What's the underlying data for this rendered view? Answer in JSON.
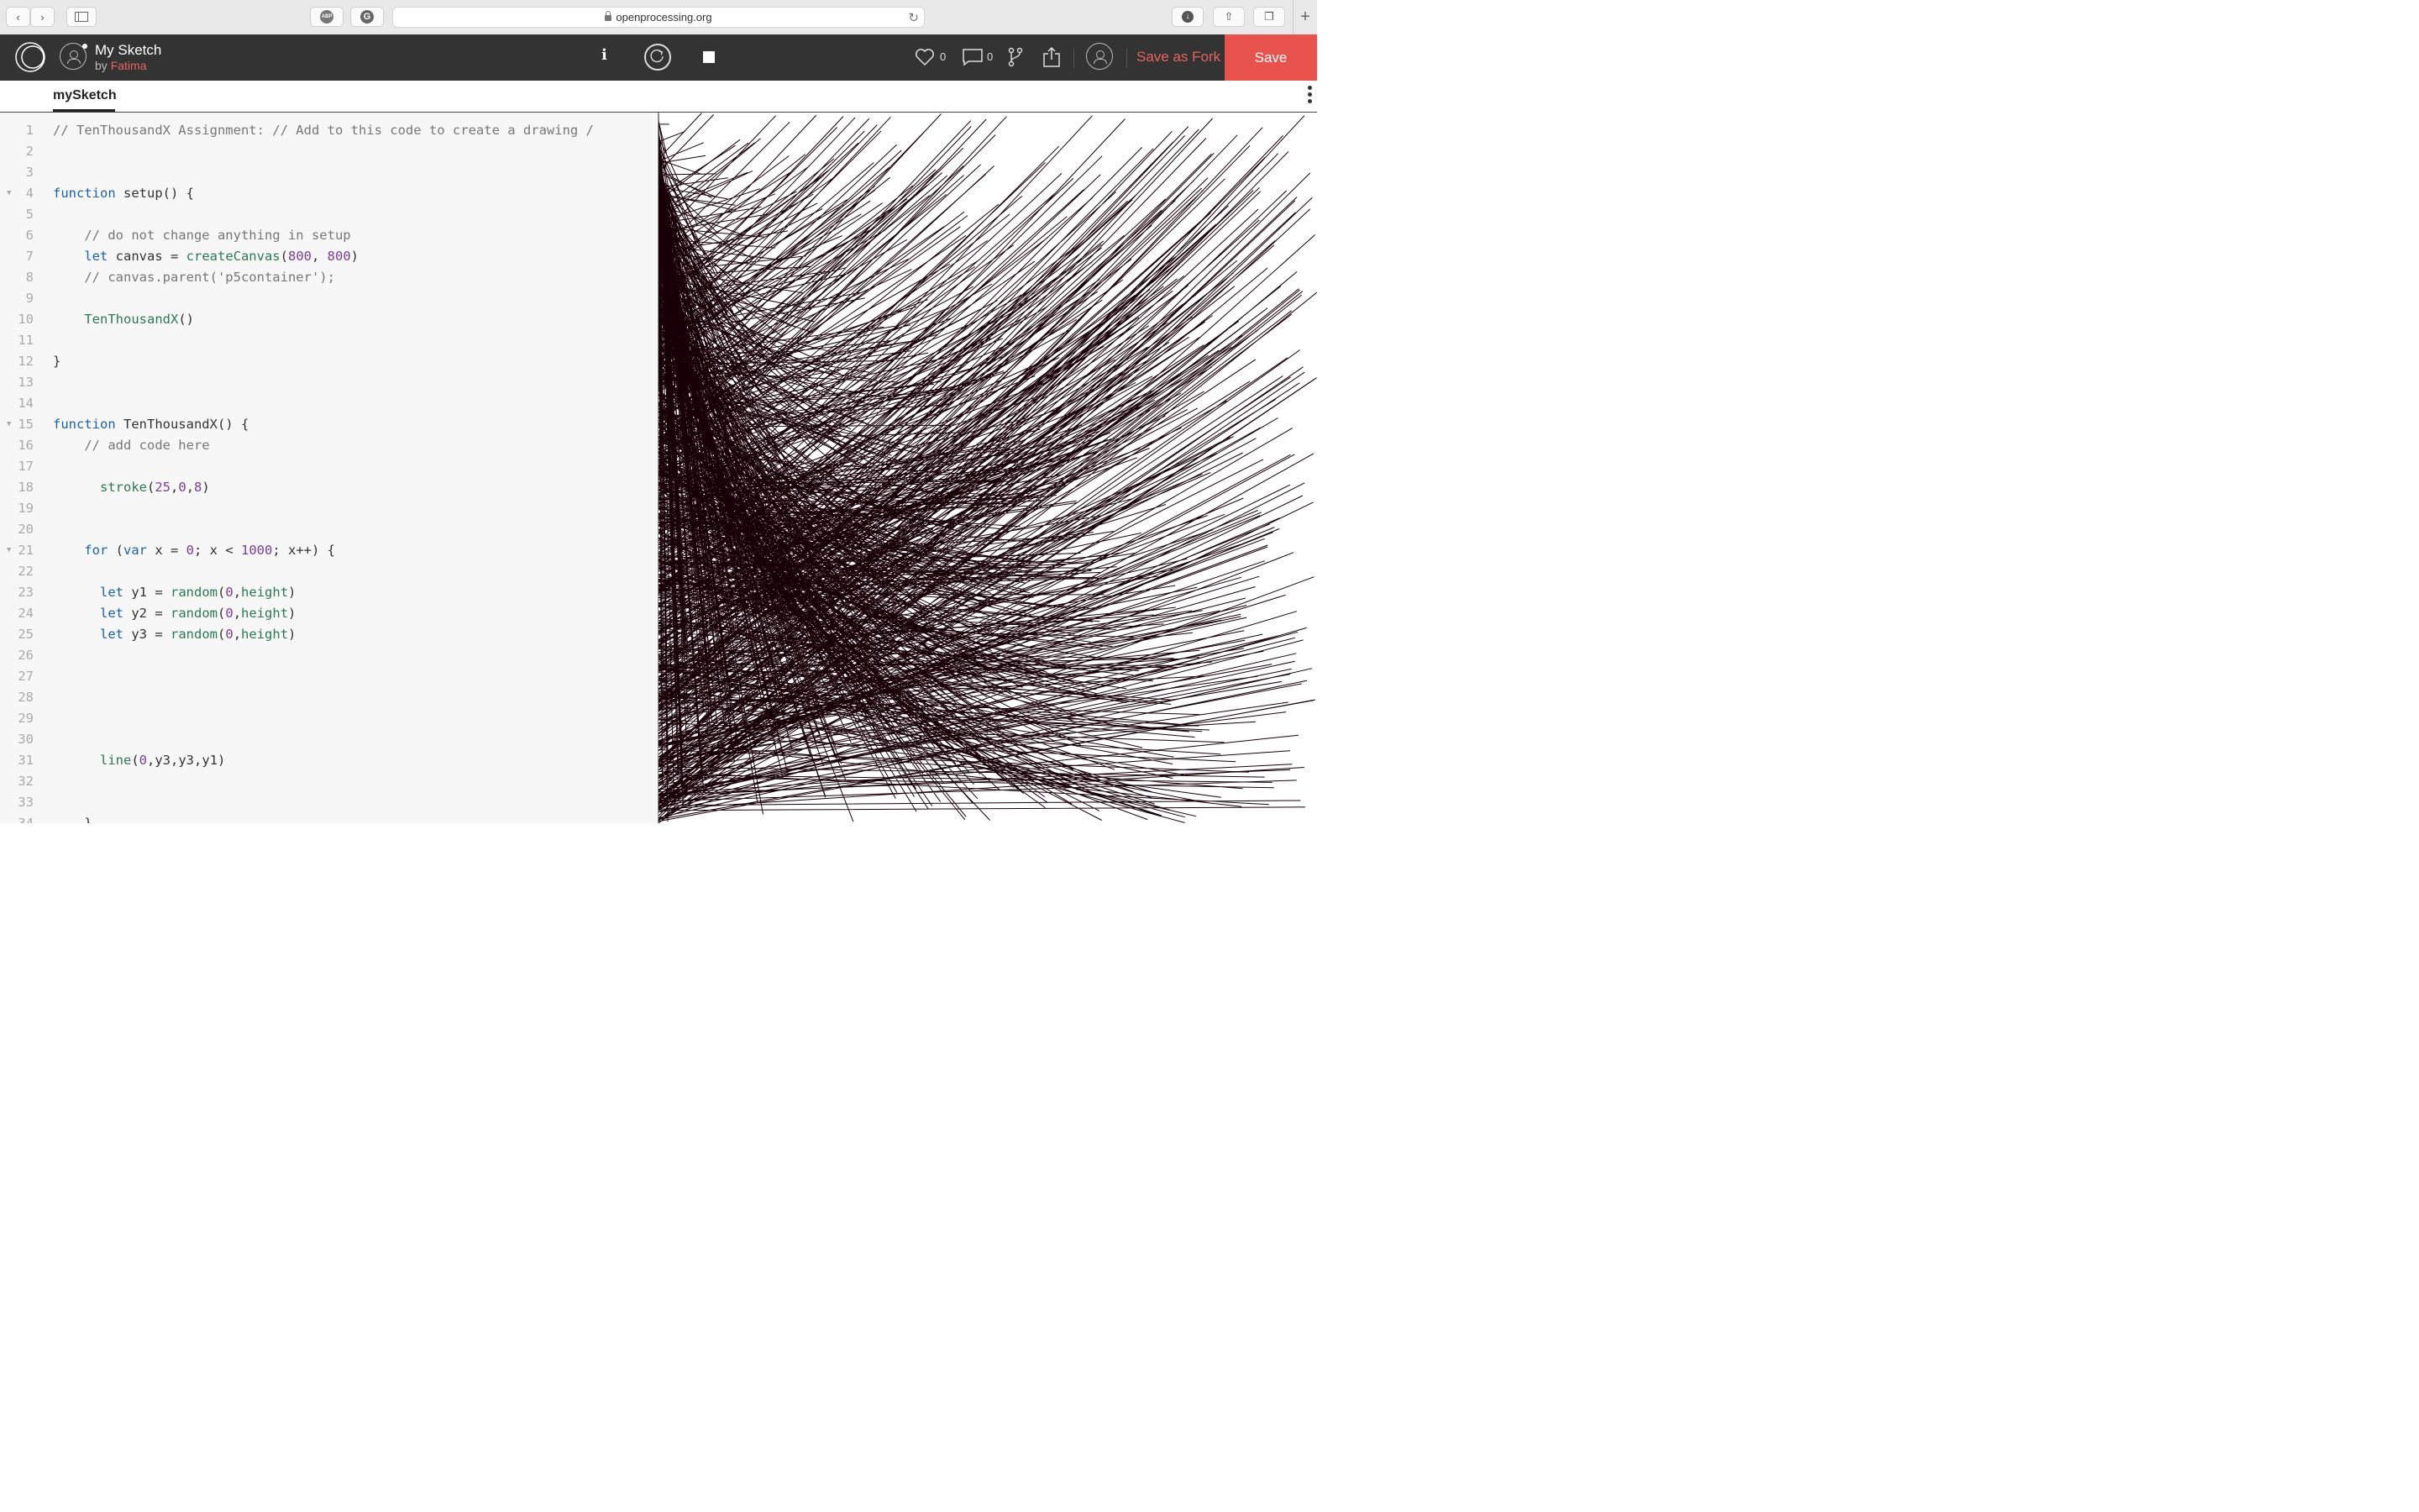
{
  "browser": {
    "url": "openprocessing.org"
  },
  "header": {
    "sketch_title": "My Sketch",
    "by_label": "by",
    "author": "Fatima",
    "info_label": "i",
    "likes_count": "0",
    "comments_count": "0",
    "save_as_fork_label": "Save as Fork",
    "save_label": "Save"
  },
  "tabs": {
    "active_tab": "mySketch"
  },
  "colors": {
    "accent": "#e8524c",
    "header_bg": "#333333",
    "stroke": "#190008"
  },
  "editor": {
    "lines": [
      {
        "n": "1",
        "text": "// TenThousandX Assignment: // Add to this code to create a drawing /"
      },
      {
        "n": "2",
        "text": ""
      },
      {
        "n": "3",
        "text": ""
      },
      {
        "n": "4",
        "text": "function setup() {",
        "fold": true
      },
      {
        "n": "5",
        "text": ""
      },
      {
        "n": "6",
        "text": "    // do not change anything in setup"
      },
      {
        "n": "7",
        "text": "    let canvas = createCanvas(800, 800)"
      },
      {
        "n": "8",
        "text": "    // canvas.parent('p5container');"
      },
      {
        "n": "9",
        "text": ""
      },
      {
        "n": "10",
        "text": "    TenThousandX()"
      },
      {
        "n": "11",
        "text": ""
      },
      {
        "n": "12",
        "text": "}"
      },
      {
        "n": "13",
        "text": ""
      },
      {
        "n": "14",
        "text": ""
      },
      {
        "n": "15",
        "text": "function TenThousandX() {",
        "fold": true
      },
      {
        "n": "16",
        "text": "    // add code here"
      },
      {
        "n": "17",
        "text": ""
      },
      {
        "n": "18",
        "text": "      stroke(25,0,8)"
      },
      {
        "n": "19",
        "text": ""
      },
      {
        "n": "20",
        "text": ""
      },
      {
        "n": "21",
        "text": "    for (var x = 0; x < 1000; x++) {",
        "fold": true
      },
      {
        "n": "22",
        "text": ""
      },
      {
        "n": "23",
        "text": "      let y1 = random(0,height)"
      },
      {
        "n": "24",
        "text": "      let y2 = random(0,height)"
      },
      {
        "n": "25",
        "text": "      let y3 = random(0,height)"
      },
      {
        "n": "26",
        "text": ""
      },
      {
        "n": "27",
        "text": ""
      },
      {
        "n": "28",
        "text": ""
      },
      {
        "n": "29",
        "text": ""
      },
      {
        "n": "30",
        "text": ""
      },
      {
        "n": "31",
        "text": "      line(0,y3,y3,y1)"
      },
      {
        "n": "32",
        "text": ""
      },
      {
        "n": "33",
        "text": ""
      },
      {
        "n": "34",
        "text": "    }"
      }
    ]
  },
  "sketch": {
    "line_count": 1000
  }
}
